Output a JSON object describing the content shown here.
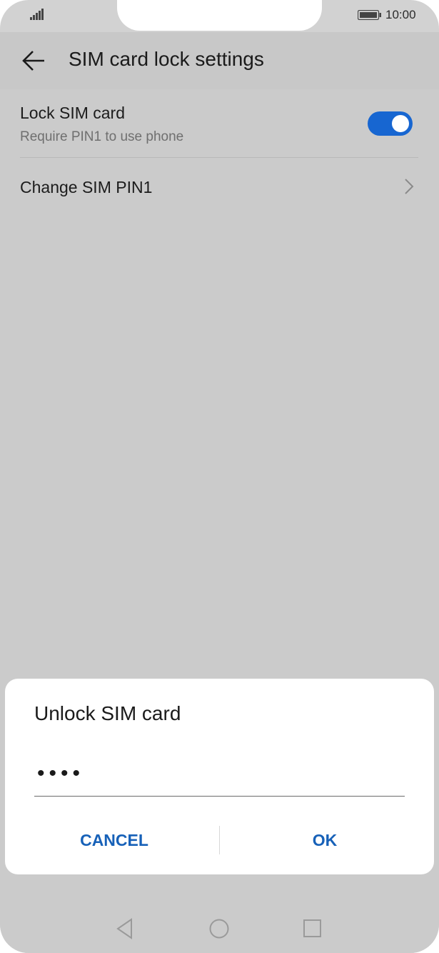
{
  "status_bar": {
    "time": "10:00",
    "signal_icon": "signal-icon",
    "battery_icon": "battery-icon"
  },
  "app_bar": {
    "title": "SIM card lock settings",
    "back_icon": "arrow-left-icon"
  },
  "settings": {
    "lock_sim": {
      "title": "Lock SIM card",
      "subtitle": "Require PIN1 to use phone",
      "enabled": true
    },
    "change_pin": {
      "label": "Change SIM PIN1",
      "chevron_icon": "chevron-right-icon"
    }
  },
  "dialog": {
    "title": "Unlock SIM card",
    "pin_value": "••••",
    "cancel_label": "CANCEL",
    "ok_label": "OK"
  },
  "nav_bar": {
    "back": "triangle-back-icon",
    "home": "circle-home-icon",
    "recents": "square-recents-icon"
  },
  "colors": {
    "accent": "#1766d1",
    "button_text": "#1761b8",
    "scrim": "#cbcbcb"
  }
}
